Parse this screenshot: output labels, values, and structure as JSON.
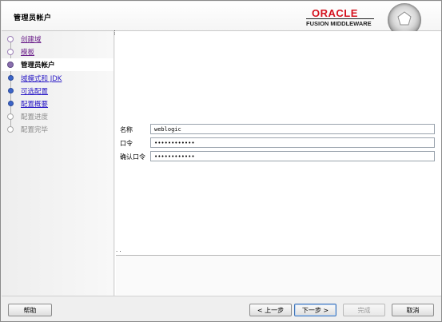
{
  "header": {
    "page_title": "管理员帐户",
    "brand": "ORACLE",
    "product": "FUSION MIDDLEWARE",
    "brand_color": "#d5121e"
  },
  "sidebar": {
    "items": [
      {
        "label": "创建域",
        "state": "done"
      },
      {
        "label": "模板",
        "state": "done"
      },
      {
        "label": "管理员帐户",
        "state": "active"
      },
      {
        "label": "域模式和 JDK",
        "state": "link"
      },
      {
        "label": "可选配置",
        "state": "link"
      },
      {
        "label": "配置概要",
        "state": "link"
      },
      {
        "label": "配置进度",
        "state": "pending"
      },
      {
        "label": "配置完毕",
        "state": "pending"
      }
    ]
  },
  "form": {
    "name_label": "名称",
    "name_value": "weblogic",
    "password_label": "口令",
    "password_value": "••••••••••••",
    "confirm_label": "确认口令",
    "confirm_value": "••••••••••••"
  },
  "footer": {
    "help": "帮助",
    "back": "< 上一步",
    "next": "下一步 >",
    "finish": "完成",
    "cancel": "取消"
  }
}
